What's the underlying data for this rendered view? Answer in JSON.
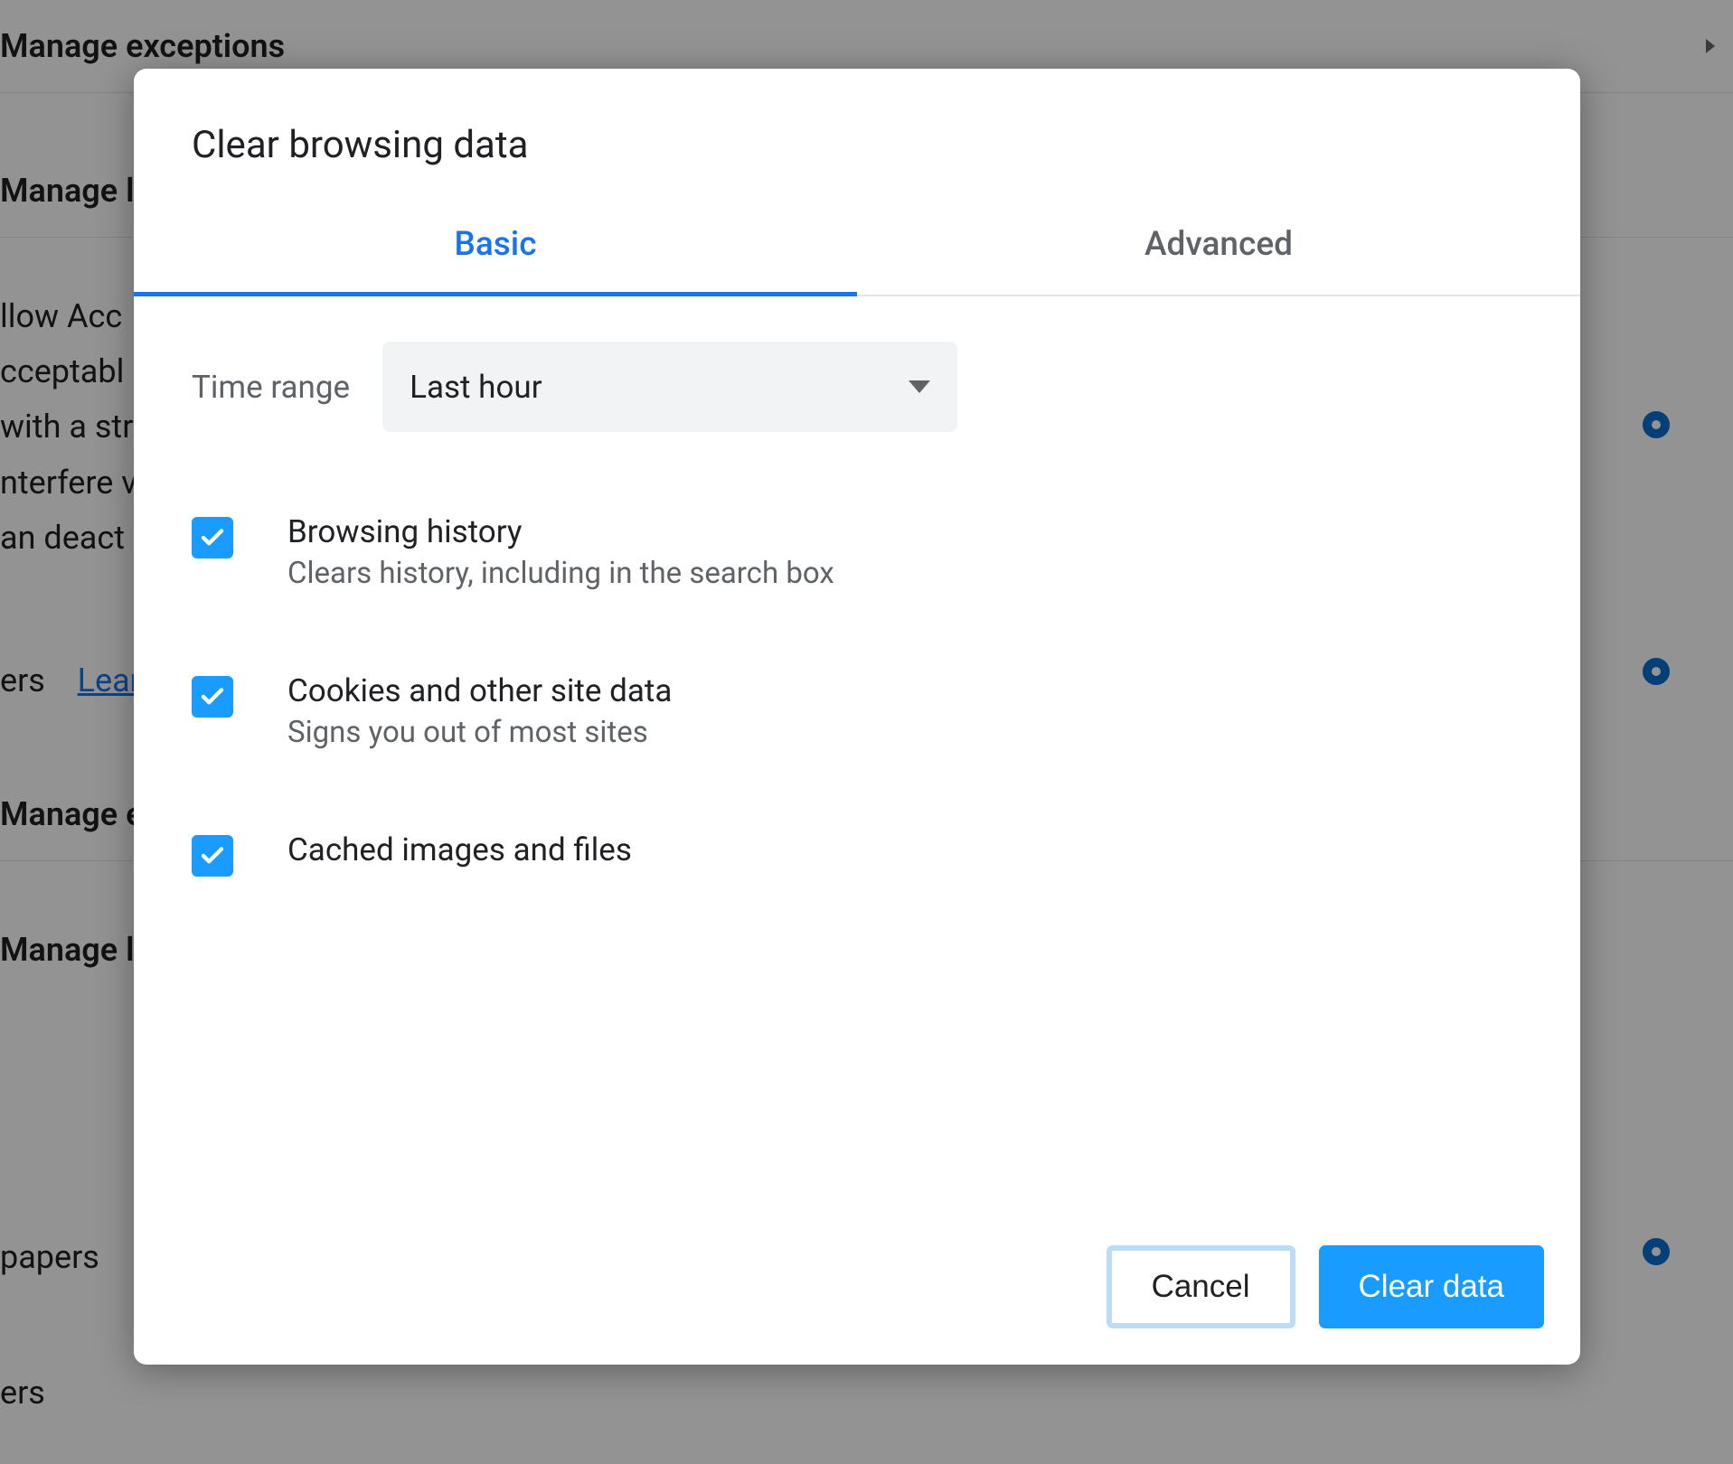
{
  "background": {
    "rows": [
      {
        "label": "Manage exceptions"
      },
      {
        "label": "Manage l"
      },
      {
        "label": "llow Acc"
      },
      {
        "label": "cceptabl"
      },
      {
        "label": "with a stri"
      },
      {
        "label": "nterfere v"
      },
      {
        "label": "an deact"
      },
      {
        "label_prefix": "ers",
        "link_text": "Learn"
      },
      {
        "label": "Manage e"
      },
      {
        "label": "Manage l"
      },
      {
        "label": "papers"
      },
      {
        "label": "ers"
      }
    ]
  },
  "modal": {
    "title": "Clear browsing data",
    "tabs": {
      "basic": "Basic",
      "advanced": "Advanced"
    },
    "time_range": {
      "label": "Time range",
      "value": "Last hour"
    },
    "options": [
      {
        "checked": true,
        "title": "Browsing history",
        "description": "Clears history, including in the search box"
      },
      {
        "checked": true,
        "title": "Cookies and other site data",
        "description": "Signs you out of most sites"
      },
      {
        "checked": true,
        "title": "Cached images and files",
        "description": ""
      }
    ],
    "buttons": {
      "cancel": "Cancel",
      "confirm": "Clear data"
    }
  }
}
